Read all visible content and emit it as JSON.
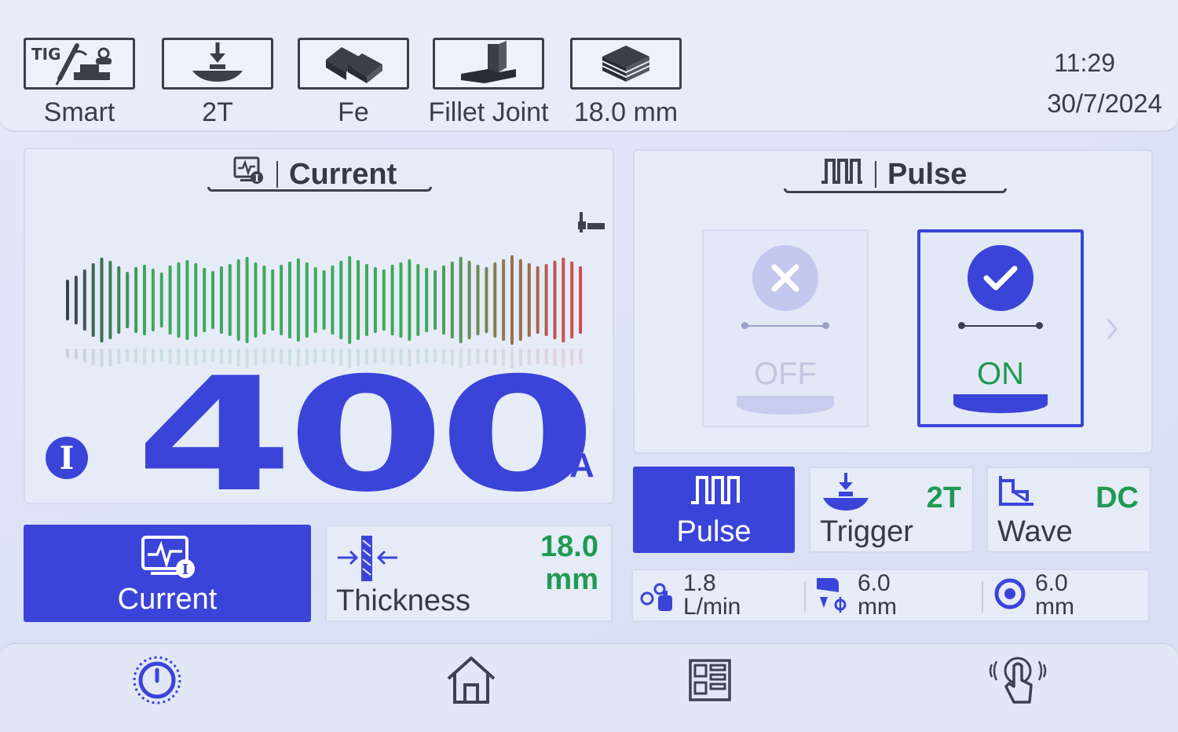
{
  "top_bar": {
    "items": [
      {
        "label": "Smart",
        "icon": "tig-torch-icon"
      },
      {
        "label": "2T",
        "icon": "trigger-2t-icon"
      },
      {
        "label": "Fe",
        "icon": "metal-bars-icon"
      },
      {
        "label": "Fillet Joint",
        "icon": "fillet-joint-icon"
      },
      {
        "label": "18.0 mm",
        "icon": "plate-stack-icon"
      }
    ],
    "tig_text": "TIG",
    "time": "11:29",
    "date": "30/7/2024"
  },
  "current_panel": {
    "title": "Current",
    "value": "400",
    "unit": "A",
    "badge": "I"
  },
  "pulse_panel": {
    "title": "Pulse",
    "off_label": "OFF",
    "on_label": "ON",
    "selected": "ON"
  },
  "buttons": {
    "current": {
      "label": "Current",
      "badge": "I"
    },
    "thickness": {
      "label": "Thickness",
      "value": "18.0",
      "unit": "mm"
    },
    "pulse": {
      "label": "Pulse"
    },
    "trigger": {
      "label": "Trigger",
      "value": "2T"
    },
    "wave": {
      "label": "Wave",
      "value": "DC"
    }
  },
  "params": {
    "gas_flow": {
      "value": "1.8",
      "unit": "L/min"
    },
    "tungsten": {
      "value": "6.0",
      "unit": "mm"
    },
    "nozzle": {
      "value": "6.0",
      "unit": "mm"
    }
  },
  "colors": {
    "accent": "#3b44d8",
    "value_green": "#1f9a52",
    "wave_green": "#3fa85a",
    "wave_red": "#d04a4a"
  },
  "waveform": {
    "bars": [
      52,
      62,
      78,
      94,
      108,
      100,
      86,
      72,
      84,
      90,
      80,
      70,
      88,
      96,
      102,
      94,
      82,
      74,
      86,
      92,
      104,
      110,
      96,
      88,
      78,
      90,
      98,
      106,
      96,
      84,
      76,
      88,
      100,
      112,
      102,
      92,
      84,
      78,
      90,
      96,
      104,
      92,
      82,
      76,
      88,
      98,
      110,
      100,
      90,
      84,
      96,
      104,
      114,
      104,
      94,
      86,
      92,
      100,
      108,
      98,
      86
    ]
  }
}
